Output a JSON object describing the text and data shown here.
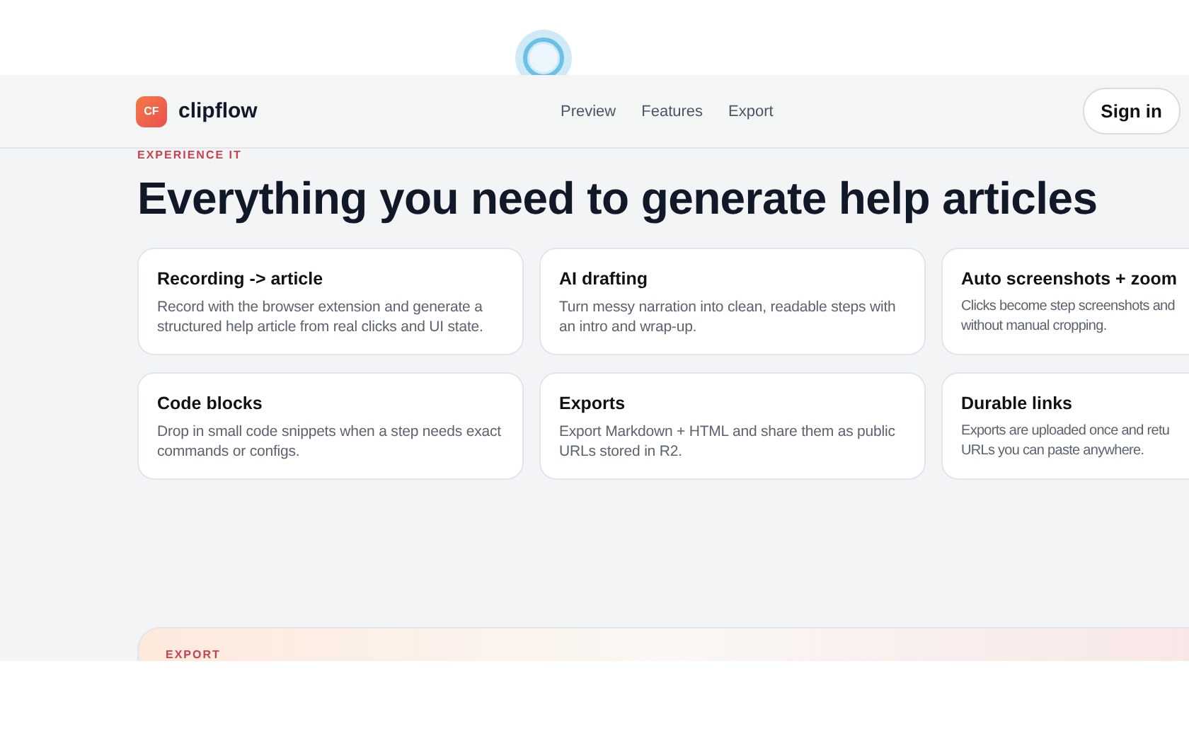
{
  "header": {
    "logo_mark": "CF",
    "brand": "clipflow",
    "nav": [
      {
        "label": "Preview",
        "selected": false
      },
      {
        "label": "Features",
        "selected": false
      },
      {
        "label": "Export",
        "selected": false
      }
    ],
    "sign_in": "Sign in"
  },
  "section": {
    "eyebrow": "EXPERIENCE IT",
    "title": "Everything you need to generate help articles",
    "cards": [
      {
        "title": "Recording -> article",
        "text": "Record with the browser extension and generate a\nstructured help article from real clicks and UI state."
      },
      {
        "title": "AI drafting",
        "text": "Turn messy narration into clean, readable steps with\nan intro and wrap-up."
      },
      {
        "title": "Auto screenshots + zoom",
        "text": "Clicks become step screenshots and\nwithout manual cropping."
      },
      {
        "title": "Code blocks",
        "text": "Drop in small code snippets when a step needs exact\ncommands or configs."
      },
      {
        "title": "Exports",
        "text": "Export Markdown + HTML and share them as public\nURLs stored in R2."
      },
      {
        "title": "Durable links",
        "text": "Exports are uploaded once and retu\nURLs you can paste anywhere."
      }
    ]
  },
  "export_section": {
    "eyebrow": "EXPORT"
  }
}
